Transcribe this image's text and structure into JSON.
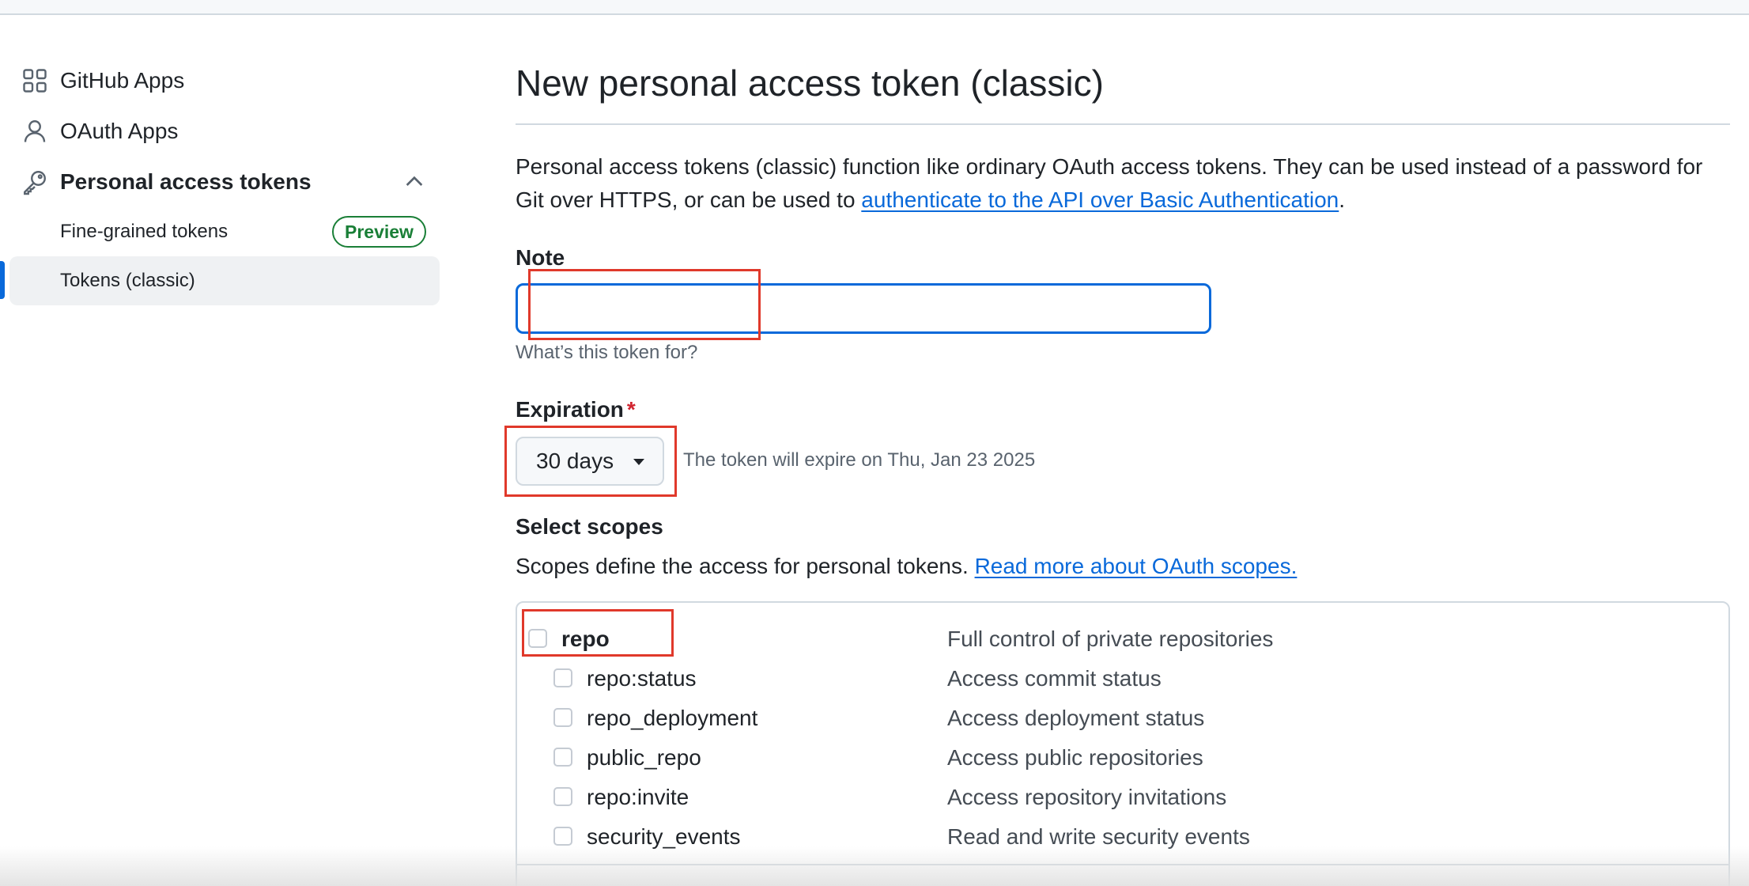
{
  "sidebar": {
    "items": [
      {
        "label": "GitHub Apps",
        "icon": "apps-grid-icon"
      },
      {
        "label": "OAuth Apps",
        "icon": "person-icon"
      },
      {
        "label": "Personal access tokens",
        "icon": "key-icon",
        "expanded": true
      }
    ],
    "subitems": [
      {
        "label": "Fine-grained tokens",
        "badge": "Preview"
      },
      {
        "label": "Tokens (classic)",
        "active": true
      }
    ]
  },
  "main": {
    "title": "New personal access token (classic)",
    "intro_text": "Personal access tokens (classic) function like ordinary OAuth access tokens. They can be used instead of a password for Git over HTTPS, or can be used to ",
    "intro_link": "authenticate to the API over Basic Authentication",
    "intro_end": ".",
    "note": {
      "label": "Note",
      "value": "",
      "hint": "What’s this token for?"
    },
    "expiration": {
      "label": "Expiration",
      "required_mark": "*",
      "selected": "30 days",
      "note": "The token will expire on Thu, Jan 23 2025"
    },
    "scopes": {
      "heading": "Select scopes",
      "description": "Scopes define the access for personal tokens. ",
      "link": "Read more about OAuth scopes.",
      "rows": [
        {
          "name": "repo",
          "desc": "Full control of private repositories",
          "checked": false
        },
        {
          "name": "repo:status",
          "desc": "Access commit status",
          "checked": false
        },
        {
          "name": "repo_deployment",
          "desc": "Access deployment status",
          "checked": false
        },
        {
          "name": "public_repo",
          "desc": "Access public repositories",
          "checked": false
        },
        {
          "name": "repo:invite",
          "desc": "Access repository invitations",
          "checked": false
        },
        {
          "name": "security_events",
          "desc": "Read and write security events",
          "checked": false
        }
      ]
    }
  },
  "colors": {
    "accent": "#0969da",
    "badge_green": "#1a7f37",
    "required_red": "#d1242f",
    "annotation_red": "#e0392b"
  }
}
